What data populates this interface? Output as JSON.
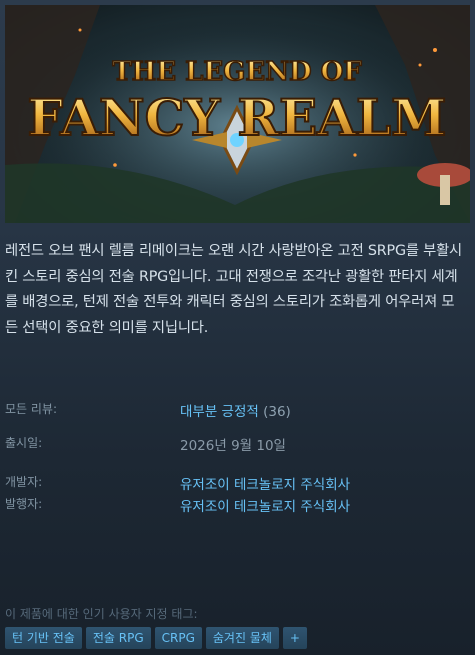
{
  "capsule": {
    "logo_top": "THE LEGEND OF",
    "logo_main": "FANCY REALM"
  },
  "description": "레전드 오브 팬시 렐름 리메이크는 오랜 시간 사랑받아온 고전 SRPG를 부활시킨 스토리 중심의 전술 RPG입니다. 고대 전쟁으로 조각난 광활한 판타지 세계를 배경으로, 턴제 전술 전투와 캐릭터 중심의 스토리가 조화롭게 어우러져 모든 선택이 중요한 의미를 지닙니다.",
  "info": {
    "reviews_label": "모든 리뷰:",
    "reviews_value": "대부분 긍정적",
    "reviews_count": "(36)",
    "release_label": "출시일:",
    "release_value": "2026년 9월 10일",
    "developer_label": "개발자:",
    "developer_value": "유저조이 테크놀로지 주식회사",
    "publisher_label": "발행자:",
    "publisher_value": "유저조이 테크놀로지 주식회사"
  },
  "tags": {
    "title": "이 제품에 대한 인기 사용자 지정 태그:",
    "items": [
      "턴 기반 전술",
      "전술 RPG",
      "CRPG",
      "숨겨진 물체",
      "+"
    ]
  },
  "colors": {
    "link": "#67c1f5",
    "tag_bg": "#2a475e",
    "label": "#8194a3"
  }
}
